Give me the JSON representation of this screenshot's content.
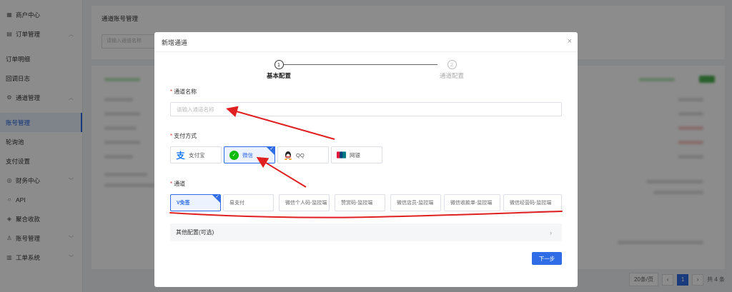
{
  "sidebar": {
    "items": [
      {
        "label": "商户中心",
        "icon": "grid-icon"
      },
      {
        "label": "订单管理",
        "icon": "order-icon"
      },
      {
        "label": "订单明细"
      },
      {
        "label": "回调日志"
      },
      {
        "label": "通道管理",
        "icon": "settings-icon"
      },
      {
        "label": "账号管理"
      },
      {
        "label": "轮询池"
      },
      {
        "label": "支付设置"
      },
      {
        "label": "财务中心",
        "icon": "finance-icon"
      },
      {
        "label": "API",
        "icon": "api-icon"
      },
      {
        "label": "聚合收款",
        "icon": "aggregate-icon"
      },
      {
        "label": "账号管理",
        "icon": "user-icon"
      },
      {
        "label": "工单系统",
        "icon": "ticket-icon"
      }
    ]
  },
  "background": {
    "page_title": "通道账号管理",
    "search_placeholder": "请输入通道名称",
    "pager": {
      "size": "20条/页",
      "page": "1",
      "total": "共 4 条"
    }
  },
  "modal": {
    "title": "新增通道",
    "steps": [
      {
        "number": "1",
        "label": "基本配置"
      },
      {
        "number": "2",
        "label": "通道配置"
      }
    ],
    "name_label": "通道名称",
    "name_placeholder": "请输入通道名称",
    "pay_label": "支付方式",
    "pay_methods": [
      {
        "label": "支付宝"
      },
      {
        "label": "微信",
        "selected": true
      },
      {
        "label": "QQ"
      },
      {
        "label": "网银"
      }
    ],
    "channel_label": "通道",
    "channels": [
      {
        "label": "V免签",
        "selected": true
      },
      {
        "label": "易支付"
      },
      {
        "label": "微信个人码-监控端"
      },
      {
        "label": "赞赏码-监控端"
      },
      {
        "label": "微信店员-监控端"
      },
      {
        "label": "微信收款单-监控端"
      },
      {
        "label": "微信经营码-监控端"
      }
    ],
    "more_config": "其他配置(可选)",
    "next_button": "下一步"
  },
  "colors": {
    "primary": "#2f6ce5",
    "annotation": "#e02020",
    "required": "#e53935"
  }
}
